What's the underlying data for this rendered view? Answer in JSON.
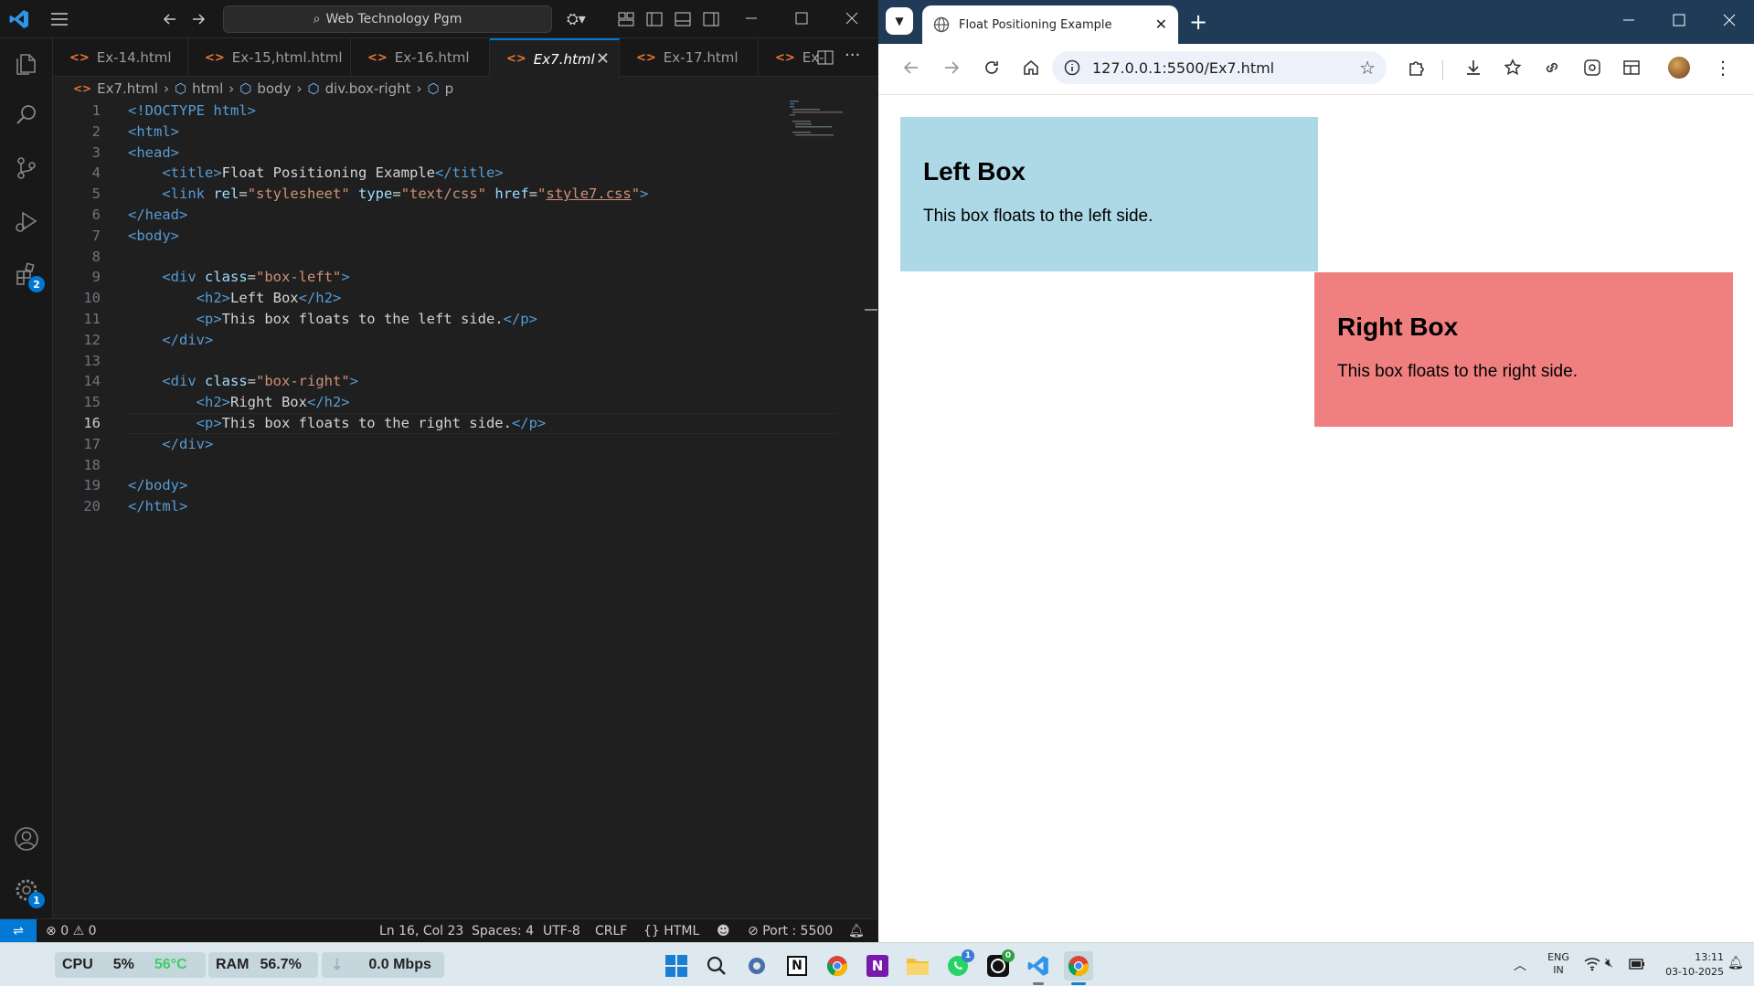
{
  "vscode": {
    "search_placeholder": "Web Technology Pgm",
    "tabs": [
      {
        "label": "Ex-14.html"
      },
      {
        "label": "Ex-15,html.html"
      },
      {
        "label": "Ex-16.html"
      },
      {
        "label": "Ex7.html"
      },
      {
        "label": "Ex-17.html"
      },
      {
        "label": "Ex-"
      }
    ],
    "breadcrumb": [
      "Ex7.html",
      "html",
      "body",
      "div.box-right",
      "p"
    ],
    "extensions_badge": "2",
    "settings_badge": "1",
    "line_numbers": [
      "1",
      "2",
      "3",
      "4",
      "5",
      "6",
      "7",
      "8",
      "9",
      "10",
      "11",
      "12",
      "13",
      "14",
      "15",
      "16",
      "17",
      "18",
      "19",
      "20"
    ],
    "code": {
      "l1": "<!DOCTYPE html>",
      "l2": "<html>",
      "l3": "<head>",
      "l4_text": "Float Positioning Example",
      "l5_href": "style7.css",
      "l6": "</head>",
      "l7": "<body>",
      "l9_class": "\"box-left\"",
      "l10_text": "Left Box",
      "l11_text": "This box floats to the left side.",
      "l12": "</div>",
      "l14_class": "\"box-right\"",
      "l15_text": "Right Box",
      "l16_text": "This box floats to the right side.",
      "l17": "</div>",
      "l19": "</body>",
      "l20": "</html>"
    },
    "status": {
      "errors": "0",
      "warnings": "0",
      "position": "Ln 16, Col 23",
      "spaces": "Spaces: 4",
      "encoding": "UTF-8",
      "eol": "CRLF",
      "language": "HTML",
      "port": "Port : 5500"
    }
  },
  "browser": {
    "tab_title": "Float Positioning Example",
    "url": "127.0.0.1:5500/Ex7.html",
    "page": {
      "left_box": {
        "heading": "Left Box",
        "text": "This box floats to the left side.",
        "color": "#add8e6"
      },
      "right_box": {
        "heading": "Right Box",
        "text": "This box floats to the right side.",
        "color": "#f08080"
      }
    }
  },
  "taskbar": {
    "cpu_label": "CPU",
    "cpu_value": "5%",
    "cpu_temp": "56°C",
    "ram_label": "RAM",
    "ram_value": "56.7%",
    "net_value": "0.0 Mbps",
    "lang": "ENG",
    "region": "IN",
    "time": "13:11",
    "date": "03-10-2025",
    "whatsapp_badge": "1",
    "github_badge": "0"
  },
  "colors": {
    "accent": "#0078d4",
    "browser_frame": "#1f3b57"
  }
}
